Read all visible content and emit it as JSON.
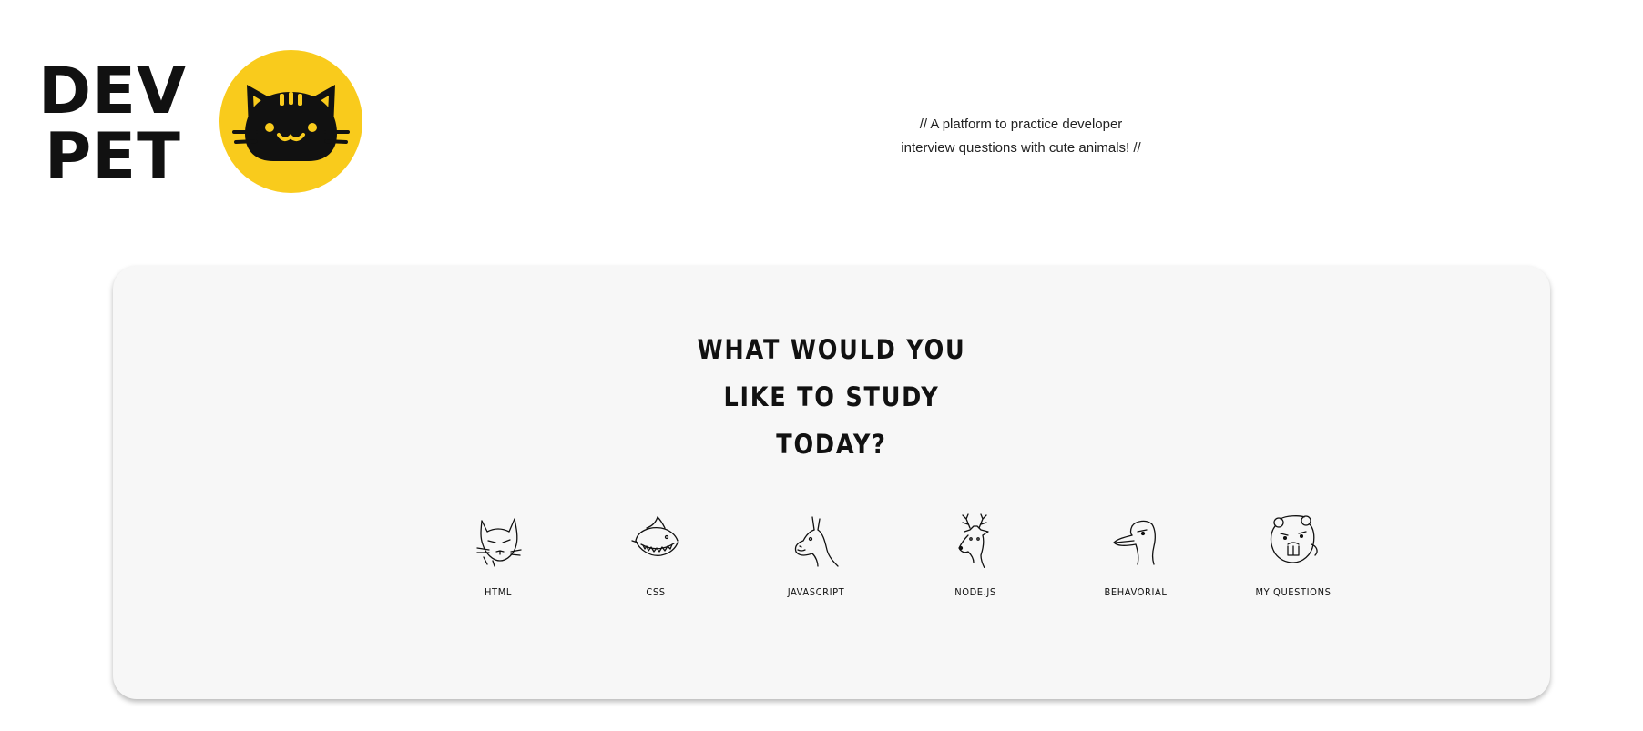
{
  "brand": {
    "line1": "DEV",
    "line2": "PET",
    "logo_icon": "cat-face-icon",
    "badge_color": "#f9cb1c"
  },
  "tagline": {
    "line1": "// A platform to practice developer",
    "line2": "interview questions with cute animals! //"
  },
  "study": {
    "heading_line1": "WHAT WOULD YOU",
    "heading_line2": "LIKE TO STUDY",
    "heading_line3": "TODAY?",
    "topics": [
      {
        "label": "HTML",
        "icon": "cat-icon"
      },
      {
        "label": "CSS",
        "icon": "shark-icon"
      },
      {
        "label": "JAVASCRIPT",
        "icon": "llama-icon"
      },
      {
        "label": "NODE.JS",
        "icon": "deer-icon"
      },
      {
        "label": "BEHAVORIAL",
        "icon": "duck-icon"
      },
      {
        "label": "MY QUESTIONS",
        "icon": "beaver-icon"
      }
    ]
  },
  "colors": {
    "accent": "#f9cb1c",
    "panel": "#f7f7f7",
    "text": "#111111"
  }
}
